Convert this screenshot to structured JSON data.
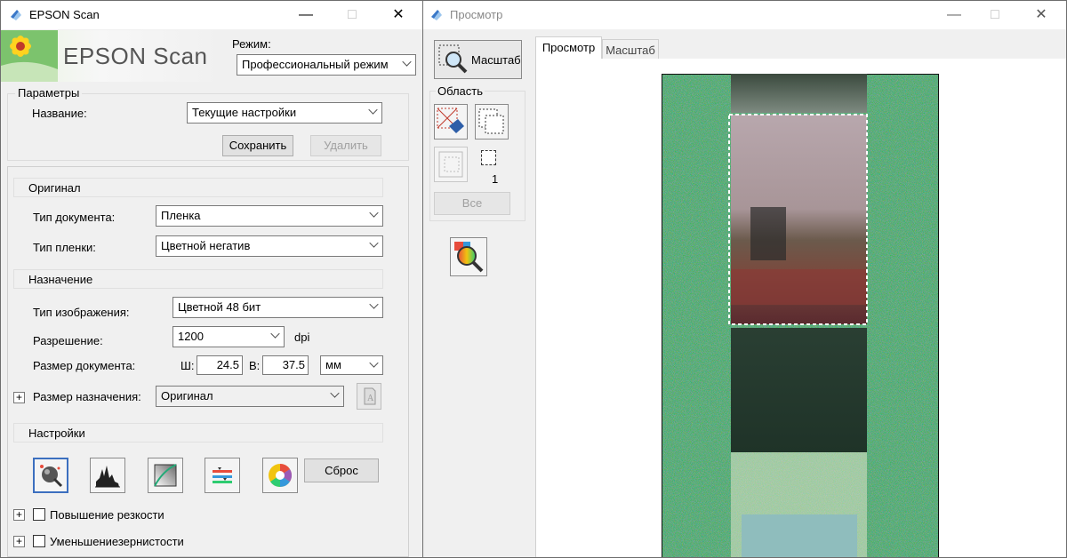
{
  "main_window": {
    "title": "EPSON Scan",
    "logo_text": "EPSON Scan",
    "mode_label": "Режим:",
    "mode_value": "Профессиональный режим",
    "params": {
      "group_label": "Параметры",
      "name_label": "Название:",
      "name_value": "Текущие настройки",
      "save_label": "Сохранить",
      "delete_label": "Удалить"
    },
    "original": {
      "header": "Оригинал",
      "doc_type_label": "Тип документа:",
      "doc_type_value": "Пленка",
      "film_type_label": "Тип пленки:",
      "film_type_value": "Цветной негатив"
    },
    "destination": {
      "header": "Назначение",
      "image_type_label": "Тип изображения:",
      "image_type_value": "Цветной 48 бит",
      "resolution_label": "Разрешение:",
      "resolution_value": "1200",
      "resolution_unit": "dpi",
      "doc_size_label": "Размер документа:",
      "width_label": "Ш:",
      "width_value": "24.5",
      "height_label": "В:",
      "height_value": "37.5",
      "unit_value": "мм",
      "target_size_label": "Размер назначения:",
      "target_size_value": "Оригинал"
    },
    "settings": {
      "header": "Настройки",
      "reset_label": "Сброс",
      "sharpen_label": "Повышение резкости",
      "grain_label": "Уменьшениезернистости"
    }
  },
  "preview_window": {
    "title": "Просмотр",
    "zoom_button_label": "Масштаб",
    "area_label": "Область",
    "marquee_count": "1",
    "all_label": "Все",
    "tabs": [
      "Просмотр",
      "Масштаб"
    ]
  },
  "colors": {
    "film_green": "#3fa86a",
    "marquee": "#ffffff"
  }
}
